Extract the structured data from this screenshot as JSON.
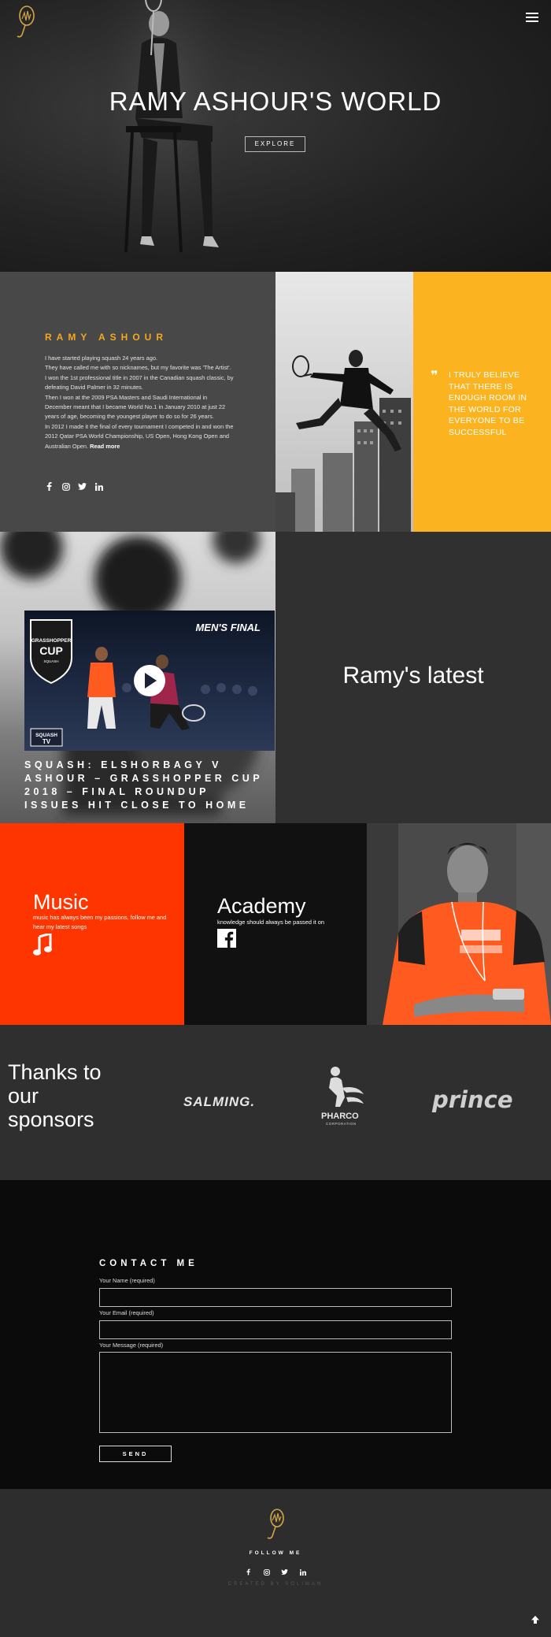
{
  "hero": {
    "title": "RAMY ASHOUR'S WORLD",
    "explore_label": "EXPLORE",
    "logo_icon": "squash-racket-logo-icon",
    "menu_icon": "hamburger-menu-icon"
  },
  "about": {
    "name": "RAMY ASHOUR",
    "paragraphs": [
      "I have started playing squash 24 years ago.",
      "They have called me with so nicknames, but my favorite was 'The Artist'.",
      "I won the 1st professional title in 2007 in the Canadian squash classic, by defeating David Palmer in 32 minutes.",
      "Then I won at the 2009 PSA Masters and Saudi International in December meant that I became World No.1 in January 2010 at just 22 years of age, becoming the youngest player to do so for 26 years.",
      "In 2012 I made it the final of every tournament I competed in and won the 2012 Qatar PSA World Championship, US Open, Hong Kong Open and Australian Open."
    ],
    "read_more": "Read more",
    "accent_color": "#f6a81e"
  },
  "quote": {
    "mark": "❞",
    "text": "I TRULY BELIEVE THAT THERE IS ENOUGH ROOM IN THE WORLD FOR EVERYONE TO BE SUCCESSFUL",
    "background": "#fbb420"
  },
  "video": {
    "badge_top": "GRASSHOPPER",
    "badge_main": "CUP",
    "badge_sub": "SQUASH",
    "overlay_text": "MEN'S FINAL",
    "tv_logo_top": "SQUASH",
    "tv_logo_bottom": "TV",
    "title": "SQUASH: ELSHORBAGY V ASHOUR – GRASSHOPPER CUP 2018 – FINAL ROUNDUP ISSUES HIT CLOSE TO HOME"
  },
  "latest": {
    "title": "Ramy's latest"
  },
  "music": {
    "title": "Music",
    "subtitle": "music has always been my passions, follow me and hear my latest songs",
    "icon": "music-note-icon",
    "background": "#ff3500"
  },
  "academy": {
    "title": "Academy",
    "subtitle": "knowledge should always be passed it on",
    "icon": "facebook-icon"
  },
  "sponsors": {
    "title": "Thanks to our sponsors",
    "items": [
      {
        "name": "SALMING."
      },
      {
        "name": "PHARCO",
        "tagline": "CORPORATION"
      },
      {
        "name": "prince"
      }
    ]
  },
  "contact": {
    "title": "CONTACT ME",
    "name_label": "Your Name (required)",
    "email_label": "Your Email (required)",
    "message_label": "Your Message (required)",
    "send_label": "SEND"
  },
  "footer": {
    "follow_label": "FOLLOW ME",
    "credits": "CREATED BY SOLIMAN",
    "to_top_icon": "arrow-up-icon"
  }
}
